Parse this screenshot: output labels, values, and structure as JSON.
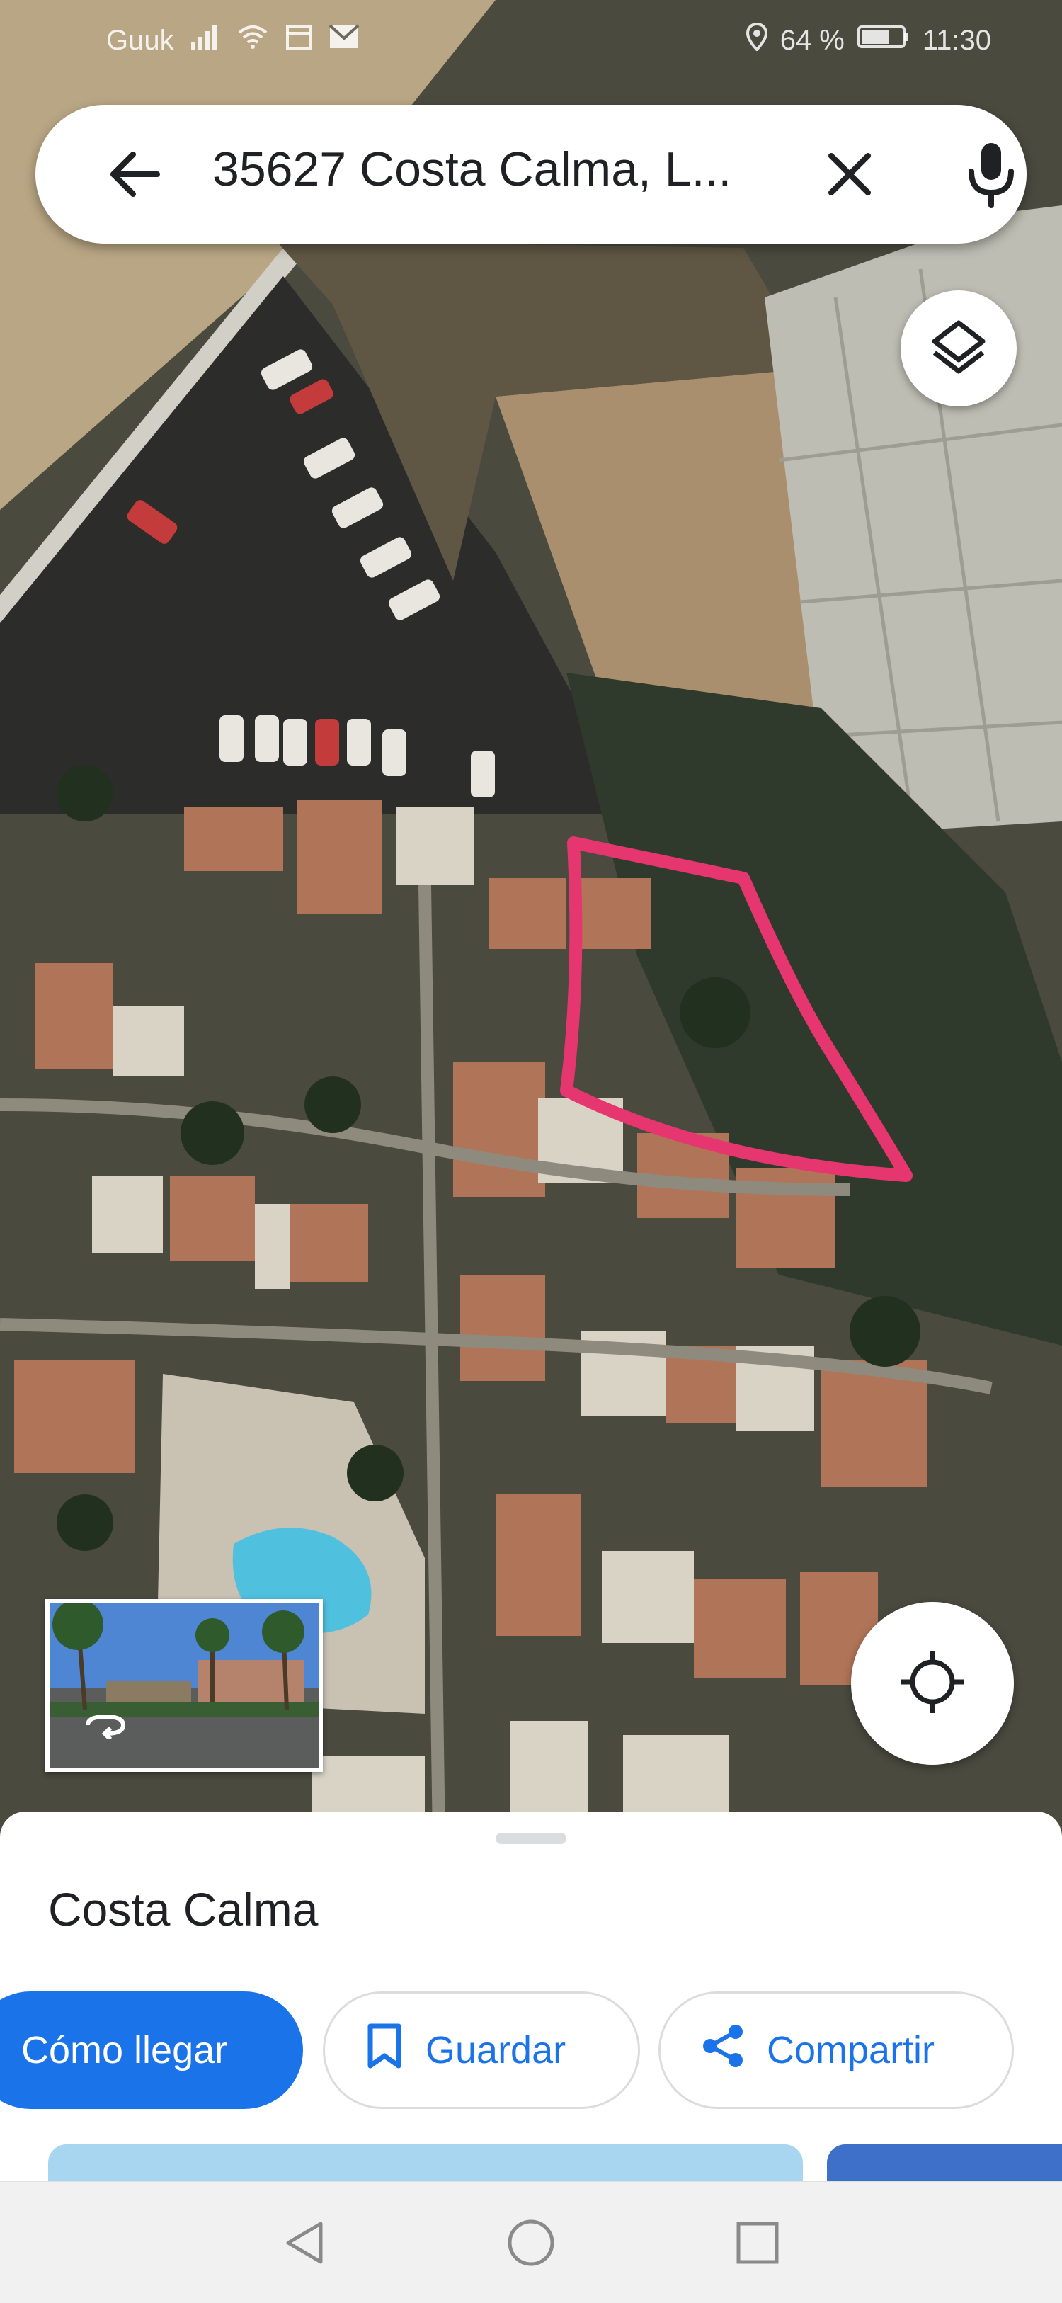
{
  "status_bar": {
    "carrier": "Guuk",
    "battery_percent": "64 %",
    "time": "11:30",
    "icons": [
      "signal-icon",
      "wifi-icon",
      "calendar-icon",
      "mail-icon",
      "location-pin-icon",
      "battery-icon"
    ]
  },
  "search": {
    "query": "35627 Costa Calma, L...",
    "back_icon": "arrow-back-icon",
    "clear_icon": "close-icon",
    "voice_icon": "mic-icon"
  },
  "map": {
    "layers_icon": "layers-icon",
    "locate_icon": "my-location-icon",
    "streetview_icon": "360-rotate-icon",
    "outline_color": "#e5366f"
  },
  "place": {
    "title": "Costa Calma"
  },
  "actions": {
    "directions_label": "Cómo llegar",
    "save_label": "Guardar",
    "share_label": "Compartir",
    "save_icon": "bookmark-icon",
    "share_icon": "share-icon"
  },
  "colors": {
    "accent": "#1a73e8",
    "sheet_bg": "#ffffff"
  },
  "nav": {
    "back_icon": "nav-back-icon",
    "home_icon": "nav-home-icon",
    "recents_icon": "nav-recents-icon"
  }
}
